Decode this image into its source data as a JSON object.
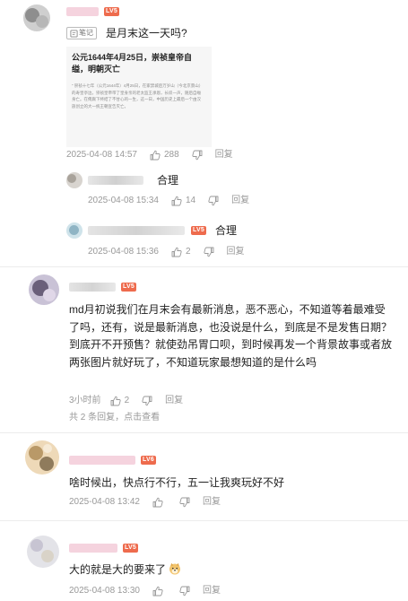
{
  "comments": [
    {
      "level": "LV5",
      "note_label": "笔记",
      "text": "是月末这一天吗?",
      "card": {
        "title": "公元1644年4月25日，崇祯皇帝自缢，明朝灭亡",
        "body": "“ 崇祯十七年（公元1644年）4月25日，在家禁城后万岁山（今北京景山）的寿皇亭边，崇祯皇帝带了皇身亲的老太监王承恩，长叹一声，随后自缢身亡。在俺腐下终结了不甘心的一生，这一日，中国历史上最后一个由汉族创立的大一统王朝宣告灭亡。"
      },
      "date": "2025-04-08 14:57",
      "likes": "288",
      "reply_label": "回复",
      "replies": [
        {
          "text": "合理",
          "date": "2025-04-08 15:34",
          "likes": "14",
          "reply_label": "回复"
        },
        {
          "level": "LV5",
          "text": "合理",
          "date": "2025-04-08 15:36",
          "likes": "2",
          "reply_label": "回复"
        }
      ]
    },
    {
      "level": "LV5",
      "text": "md月初说我们在月末会有最新消息，恶不恶心，不知道等着最难受了吗，还有，说是最新消息，也没说是什么，到底是不是发售日期？到底开不开预售？就使劲吊胃口呗，到时候再发一个背景故事或者放两张图片就好玩了，不知道玩家最想知道的是什么吗",
      "date": "3小时前",
      "likes": "2",
      "reply_label": "回复",
      "reply_summary": "共 2 条回复，点击查看"
    },
    {
      "level": "LV6",
      "text": "啥时候出，快点行不行，五一让我爽玩好不好",
      "date": "2025-04-08 13:42",
      "likes": "",
      "reply_label": "回复"
    },
    {
      "level": "LV5",
      "text": "大的就是大的要来了",
      "date": "2025-04-08 13:30",
      "likes": "",
      "reply_label": "回复"
    }
  ],
  "colors": {
    "level_badge": "#ee6b4d",
    "meta_text": "#999999",
    "divider": "#ececec"
  },
  "icons": [
    "thumbs-up-icon",
    "thumbs-down-icon",
    "note-icon",
    "doge-emoji-icon"
  ]
}
